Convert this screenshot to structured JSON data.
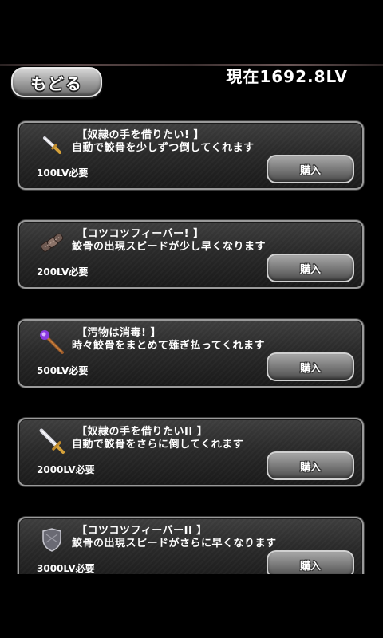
{
  "header": {
    "back_label": "もどる",
    "level_text": "現在1692.8LV"
  },
  "items": [
    {
      "icon": "dagger-icon",
      "title": "【奴隷の手を借りたい! 】",
      "desc": "自動で鮫骨を少しずつ倒してくれます",
      "requirement": "100LV必要",
      "buy_label": "購入"
    },
    {
      "icon": "rope-icon",
      "title": "【コツコツフィーバー! 】",
      "desc": "鮫骨の出現スピードが少し早くなります",
      "requirement": "200LV必要",
      "buy_label": "購入"
    },
    {
      "icon": "staff-icon",
      "title": "【汚物は消毒! 】",
      "desc": "時々鮫骨をまとめて薙ぎ払ってくれます",
      "requirement": "500LV必要",
      "buy_label": "購入"
    },
    {
      "icon": "sword-icon",
      "title": "【奴隷の手を借りたいII 】",
      "desc": "自動で鮫骨をさらに倒してくれます",
      "requirement": "2000LV必要",
      "buy_label": "購入"
    },
    {
      "icon": "shield-icon",
      "title": "【コツコツフィーバーII 】",
      "desc": "鮫骨の出現スピードがさらに早くなります",
      "requirement": "3000LV必要",
      "buy_label": "購入"
    }
  ]
}
